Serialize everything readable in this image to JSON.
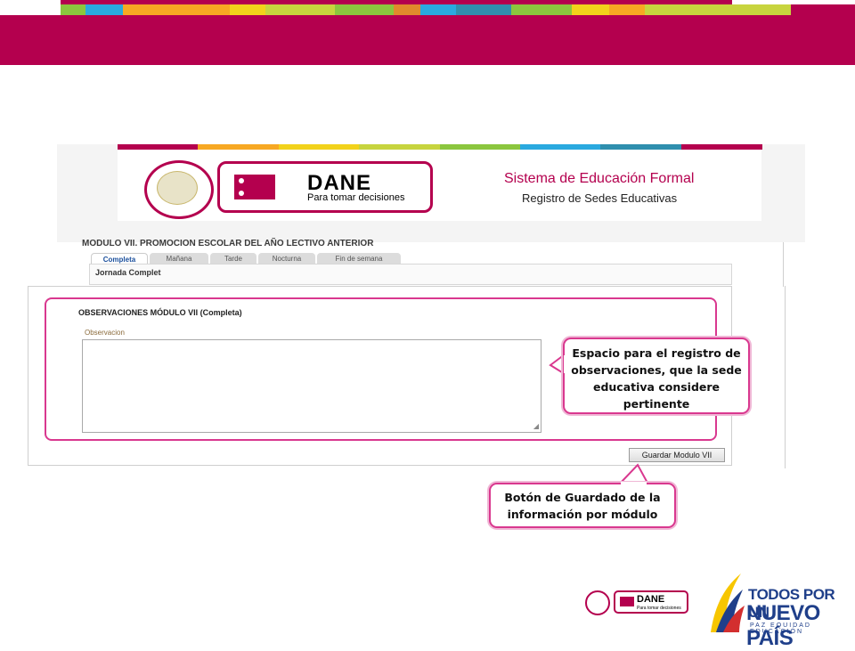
{
  "colors": {
    "brand": "#b4004e",
    "highlight": "#d9388f",
    "stripes": [
      "#8bc63e",
      "#2aa9df",
      "#f7a823",
      "#f2d21b",
      "#c7d43e",
      "#8bc63e",
      "#e08a2c",
      "#2aa9df",
      "#2f8fae",
      "#8bc63e",
      "#f2d21b",
      "#f7a823",
      "#c7d43e"
    ]
  },
  "header": {
    "logo_text": "DANE",
    "logo_tagline": "Para tomar decisiones",
    "system_title": "Sistema de Educación Formal",
    "system_subtitle": "Registro de Sedes Educativas",
    "seal_name": "colombia-seal"
  },
  "module": {
    "title": "MODULO VII. PROMOCION ESCOLAR DEL AÑO LECTIVO ANTERIOR",
    "tabs": [
      {
        "label": "Completa"
      },
      {
        "label": "Mañana"
      },
      {
        "label": "Tarde"
      },
      {
        "label": "Nocturna"
      },
      {
        "label": "Fin de semana"
      }
    ],
    "active_tab": "Completa",
    "jornada_label": "Jornada Complet"
  },
  "observaciones": {
    "heading": "OBSERVACIONES MÓDULO VII (Completa)",
    "field_label": "Observacion",
    "value": ""
  },
  "save_button": {
    "label": "Guardar Modulo VII"
  },
  "callouts": {
    "observations": "Espacio para el registro de observaciones, que la sede educativa considere pertinente",
    "save": "Botón de Guardado de la información por módulo"
  },
  "footer": {
    "dane_text": "DANE",
    "dane_tagline": "Para tomar decisiones",
    "gov_line1": "TODOS POR UN",
    "gov_line2": "NUEVO PAÍS",
    "gov_line3": "PAZ  EQUIDAD  EDUCACIÓN"
  }
}
